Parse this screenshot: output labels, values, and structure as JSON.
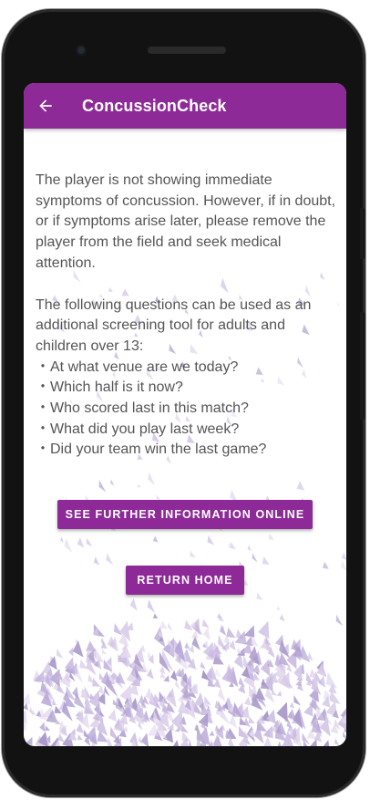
{
  "app": {
    "title": "ConcussionCheck",
    "back_icon": "arrow-back-icon",
    "accent_color": "#8e2a98"
  },
  "main": {
    "paragraph1": "The player is not showing immediate symptoms of concussion. However, if in doubt, or if symptoms arise later, please remove the player from the field and seek medical attention.",
    "paragraph2": " The following questions can be used as an additional screening tool for adults and children over 13:",
    "questions": [
      "・At what venue are we today?",
      "・Which half is it now?",
      "・Who scored last in this match?",
      "・What did you play last week?",
      "・Did your team win the last game?"
    ]
  },
  "buttons": {
    "further_info": "SEE FURTHER INFORMATION ONLINE",
    "return_home": "RETURN HOME"
  }
}
